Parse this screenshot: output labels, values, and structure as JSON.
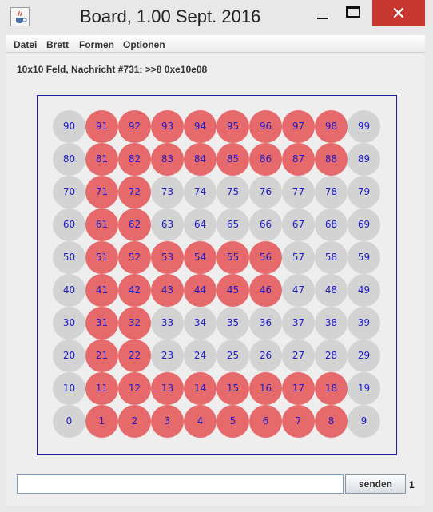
{
  "window": {
    "title": "Board, 1.00 Sept. 2016",
    "minimize_glyph": "",
    "maximize_glyph": "",
    "close_glyph": "✕"
  },
  "menu": [
    {
      "label": "Datei"
    },
    {
      "label": "Brett"
    },
    {
      "label": "Formen"
    },
    {
      "label": "Optionen"
    }
  ],
  "status_text": "10x10 Feld, Nachricht #731: >>8 0xe10e08",
  "colors": {
    "active": "#e66a6c",
    "inactive": "#d3d3d3",
    "label": "#1c1cc8",
    "board_border": "#1c1ca0",
    "close_button": "#c7372f"
  },
  "board": {
    "cols": 10,
    "rows": 10,
    "active_rows": [
      [
        91,
        92,
        93,
        94,
        95,
        96,
        97,
        98
      ],
      [
        81,
        82,
        83,
        84,
        85,
        86,
        87,
        88
      ],
      [
        71,
        72
      ],
      [
        61,
        62
      ],
      [
        51,
        52,
        53,
        54,
        55,
        56
      ],
      [
        41,
        42,
        43,
        44,
        45,
        46
      ],
      [
        31,
        32
      ],
      [
        21,
        22
      ],
      [
        11,
        12,
        13,
        14,
        15,
        16,
        17,
        18
      ],
      [
        1,
        2,
        3,
        4,
        5,
        6,
        7,
        8
      ]
    ]
  },
  "input": {
    "value": "",
    "placeholder": ""
  },
  "send_label": "senden",
  "counter": "1"
}
